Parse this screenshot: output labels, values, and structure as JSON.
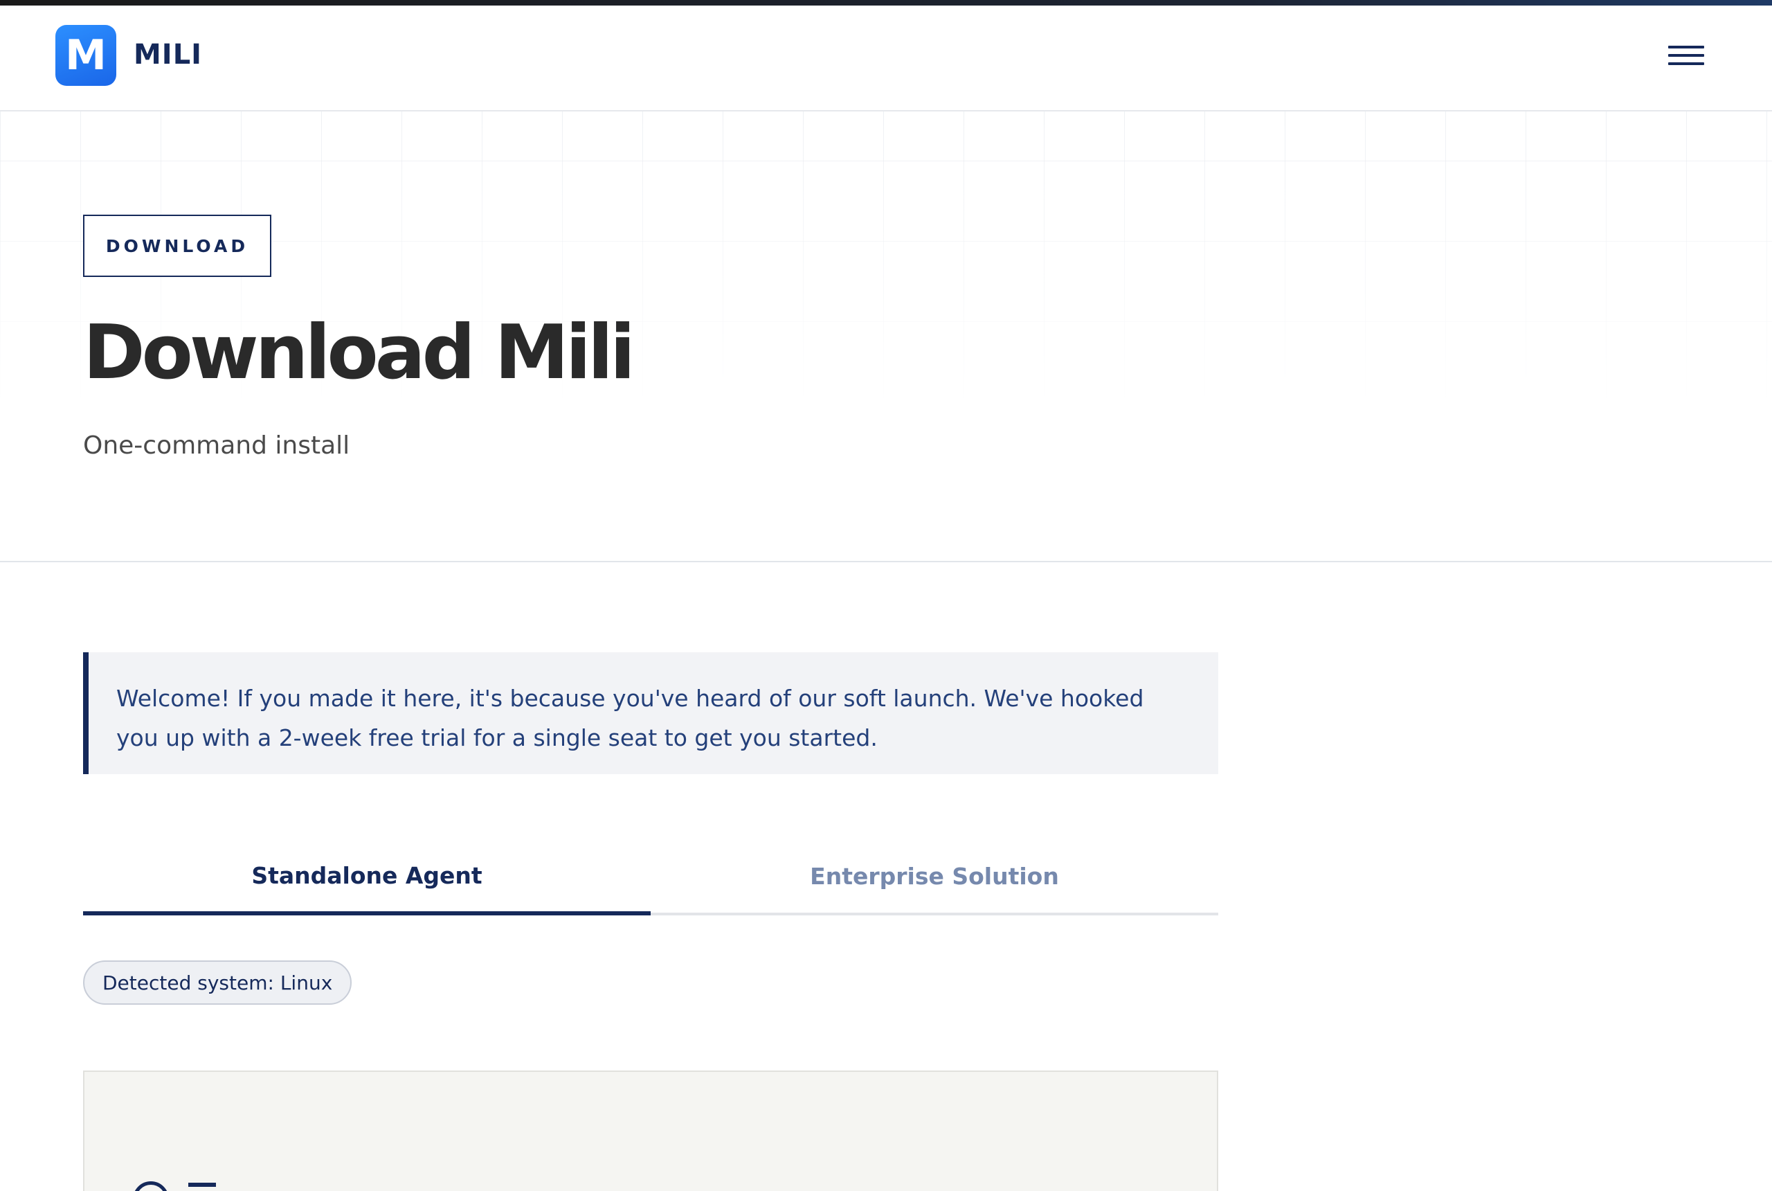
{
  "brand": {
    "logo_letter": "M",
    "name": "MILI",
    "accent": "#15295a",
    "logo_color": "#1f78f5"
  },
  "nav": {
    "menu_icon": "hamburger-menu-icon"
  },
  "hero": {
    "eyebrow": "DOWNLOAD",
    "title": "Download Mili",
    "subtitle": "One-command install"
  },
  "notice": {
    "text": "Welcome! If you made it here, it's because you've heard of our soft launch. We've hooked you up with a 2-week free trial for a single seat to get you started."
  },
  "tabs": [
    {
      "label": "Standalone Agent",
      "active": true
    },
    {
      "label": "Enterprise Solution",
      "active": false
    }
  ],
  "detected": {
    "label": "Detected system: Linux"
  }
}
